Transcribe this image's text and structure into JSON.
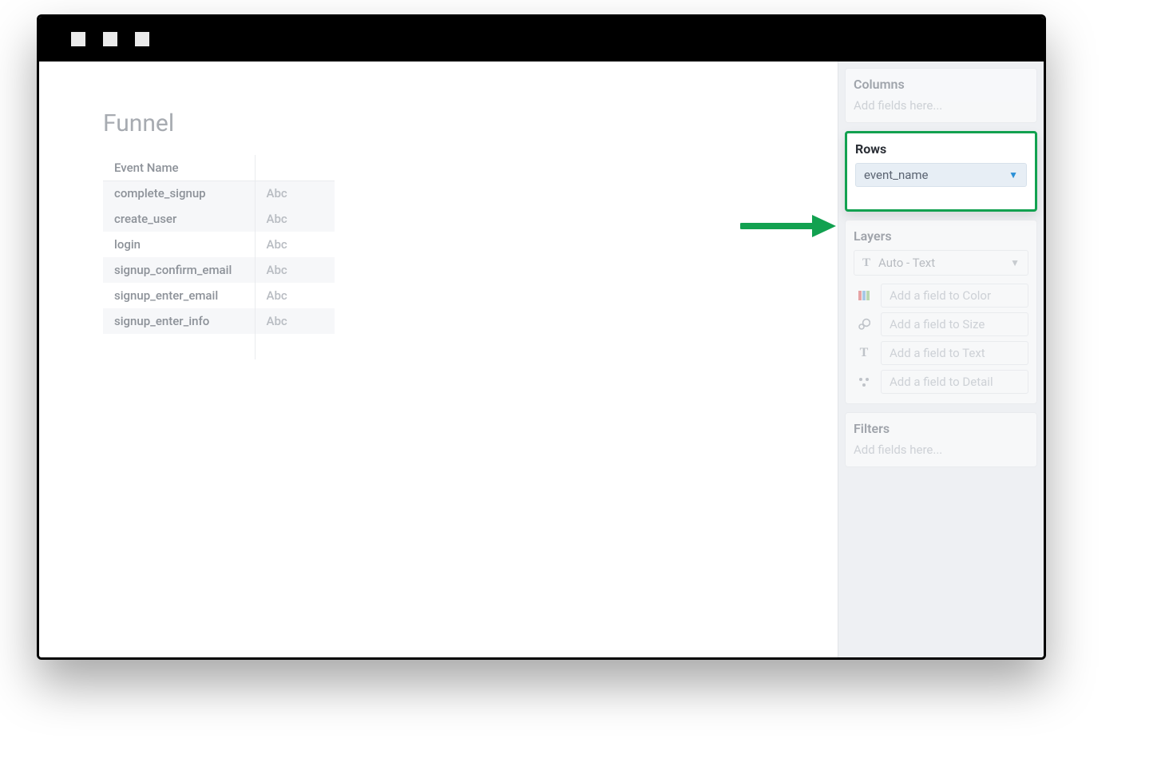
{
  "sheet": {
    "title": "Funnel"
  },
  "table": {
    "header": "Event Name",
    "value_placeholder": "Abc",
    "rows": [
      "complete_signup",
      "create_user",
      "login",
      "signup_confirm_email",
      "signup_enter_email",
      "signup_enter_info"
    ]
  },
  "sidebar": {
    "columns": {
      "title": "Columns",
      "placeholder": "Add fields here..."
    },
    "rows": {
      "title": "Rows",
      "field": "event_name"
    },
    "layers": {
      "title": "Layers",
      "selected": "Auto - Text",
      "color_placeholder": "Add a field to Color",
      "size_placeholder": "Add a field to Size",
      "text_placeholder": "Add a field to Text",
      "detail_placeholder": "Add a field to Detail"
    },
    "filters": {
      "title": "Filters",
      "placeholder": "Add fields here..."
    }
  },
  "colors": {
    "highlight": "#12a150",
    "pill_bg": "#e7eef5"
  }
}
